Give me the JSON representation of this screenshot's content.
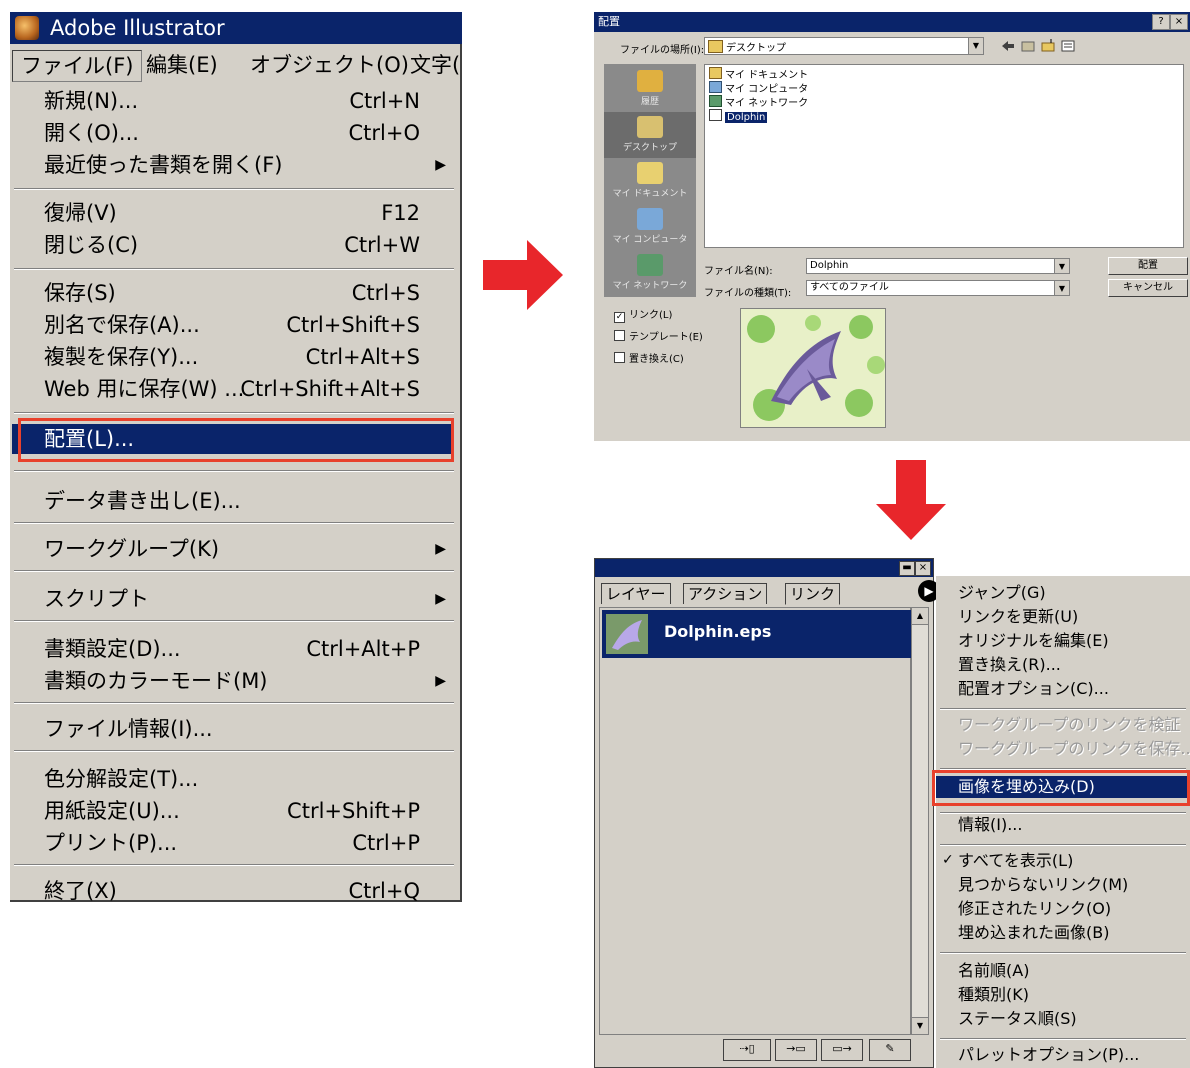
{
  "colors": {
    "highlight_box": "#e8412c",
    "menu_selection": "#0a246a",
    "arrow": "#e8262b",
    "menu_bg": "#d4d0c8"
  },
  "illustrator": {
    "app_title": "Adobe Illustrator",
    "menubar": [
      "ファイル(F)",
      "編集(E)",
      "オブジェクト(O)",
      "文字("
    ],
    "file_menu": [
      {
        "label": "新規(N)...",
        "shortcut": "Ctrl+N"
      },
      {
        "label": "開く(O)...",
        "shortcut": "Ctrl+O"
      },
      {
        "label": "最近使った書類を開く(F)",
        "shortcut": "",
        "submenu": true
      },
      {
        "label": "復帰(V)",
        "shortcut": "F12"
      },
      {
        "label": "閉じる(C)",
        "shortcut": "Ctrl+W"
      },
      {
        "label": "保存(S)",
        "shortcut": "Ctrl+S"
      },
      {
        "label": "別名で保存(A)...",
        "shortcut": "Ctrl+Shift+S"
      },
      {
        "label": "複製を保存(Y)...",
        "shortcut": "Ctrl+Alt+S"
      },
      {
        "label": "Web 用に保存(W) ...",
        "shortcut": "Ctrl+Shift+Alt+S"
      },
      {
        "label": "配置(L)...",
        "shortcut": "",
        "selected": true
      },
      {
        "label": "データ書き出し(E)...",
        "shortcut": ""
      },
      {
        "label": "ワークグループ(K)",
        "shortcut": "",
        "submenu": true
      },
      {
        "label": "スクリプト",
        "shortcut": "",
        "submenu": true
      },
      {
        "label": "書類設定(D)...",
        "shortcut": "Ctrl+Alt+P"
      },
      {
        "label": "書類のカラーモード(M)",
        "shortcut": "",
        "submenu": true
      },
      {
        "label": "ファイル情報(I)...",
        "shortcut": ""
      },
      {
        "label": "色分解設定(T)...",
        "shortcut": ""
      },
      {
        "label": "用紙設定(U)...",
        "shortcut": "Ctrl+Shift+P"
      },
      {
        "label": "プリント(P)...",
        "shortcut": "Ctrl+P"
      },
      {
        "label": "終了(X)",
        "shortcut": "Ctrl+Q"
      }
    ]
  },
  "place_dialog": {
    "title": "配置",
    "help_button": "?",
    "close_button": "×",
    "lookin_label": "ファイルの場所(I):",
    "lookin_value": "デスクトップ",
    "places": [
      "履歴",
      "デスクトップ",
      "マイ ドキュメント",
      "マイ コンピュータ",
      "マイ ネットワーク"
    ],
    "files": [
      "マイ ドキュメント",
      "マイ コンピュータ",
      "マイ ネットワーク",
      "Dolphin"
    ],
    "filename_label": "ファイル名(N):",
    "filename_value": "Dolphin",
    "filetype_label": "ファイルの種類(T):",
    "filetype_value": "すべてのファイル",
    "place_button": "配置",
    "cancel_button": "キャンセル",
    "checkboxes": [
      {
        "label": "リンク(L)",
        "checked": true
      },
      {
        "label": "テンプレート(E)",
        "checked": false
      },
      {
        "label": "置き換え(C)",
        "checked": false
      }
    ]
  },
  "links_palette": {
    "tabs": [
      "レイヤー",
      "アクション",
      "リンク"
    ],
    "items": [
      "Dolphin.eps"
    ],
    "menu": [
      {
        "label": "ジャンプ(G)"
      },
      {
        "label": "リンクを更新(U)"
      },
      {
        "label": "オリジナルを編集(E)"
      },
      {
        "label": "置き換え(R)..."
      },
      {
        "label": "配置オプション(C)..."
      },
      {
        "label": "ワークグループのリンクを検証",
        "disabled": true
      },
      {
        "label": "ワークグループのリンクを保存...",
        "disabled": true
      },
      {
        "label": "画像を埋め込み(D)",
        "selected": true
      },
      {
        "label": "情報(I)..."
      },
      {
        "label": "すべてを表示(L)",
        "checked": true
      },
      {
        "label": "見つからないリンク(M)"
      },
      {
        "label": "修正されたリンク(O)"
      },
      {
        "label": "埋め込まれた画像(B)"
      },
      {
        "label": "名前順(A)"
      },
      {
        "label": "種類別(K)"
      },
      {
        "label": "ステータス順(S)"
      },
      {
        "label": "パレットオプション(P)..."
      }
    ]
  }
}
